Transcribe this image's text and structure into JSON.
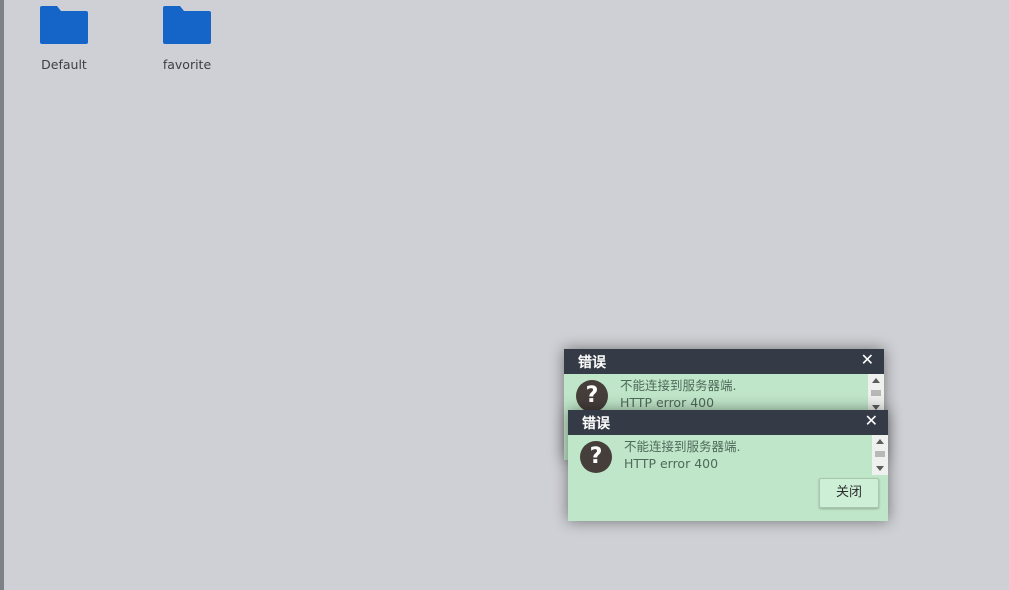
{
  "desktop": {
    "icons": [
      {
        "label": "Default",
        "icon": "folder-icon",
        "color": "#1565c8"
      },
      {
        "label": "favorite",
        "icon": "folder-icon",
        "color": "#1565c8"
      }
    ]
  },
  "dialogs": [
    {
      "title": "错误",
      "close_glyph": "✕",
      "icon": "question-icon",
      "icon_glyph": "?",
      "message_line1": "不能连接到服务器端.",
      "message_line2": "HTTP error 400"
    },
    {
      "title": "错误",
      "close_glyph": "✕",
      "icon": "question-icon",
      "icon_glyph": "?",
      "message_line1": "不能连接到服务器端.",
      "message_line2": "HTTP error 400",
      "button_label": "关闭"
    }
  ],
  "colors": {
    "desktop_bg": "#cfd0d5",
    "titlebar": "#353b46",
    "dialog_body": "#c0e6c9",
    "folder": "#1565c8"
  }
}
